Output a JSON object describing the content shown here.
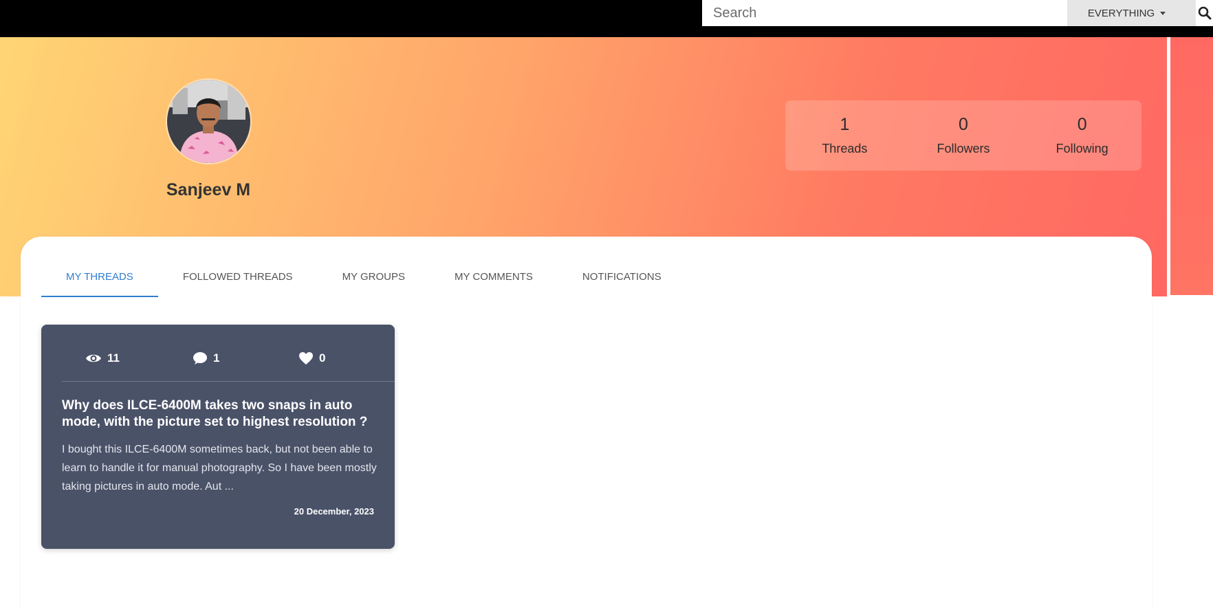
{
  "search": {
    "placeholder": "Search",
    "scope_label": "EVERYTHING"
  },
  "profile": {
    "name": "Sanjeev M",
    "stats": [
      {
        "value": "1",
        "label": "Threads"
      },
      {
        "value": "0",
        "label": "Followers"
      },
      {
        "value": "0",
        "label": "Following"
      }
    ]
  },
  "tabs": [
    {
      "label": "MY THREADS",
      "active": true
    },
    {
      "label": "FOLLOWED THREADS",
      "active": false
    },
    {
      "label": "MY GROUPS",
      "active": false
    },
    {
      "label": "MY COMMENTS",
      "active": false
    },
    {
      "label": "NOTIFICATIONS",
      "active": false
    }
  ],
  "threads": [
    {
      "views": "11",
      "comments": "1",
      "likes": "0",
      "title": "Why does ILCE-6400M takes two snaps in auto mode, with the picture set to highest resolution ?",
      "excerpt": "I bought this ILCE-6400M sometimes back, but not been able to learn to handle it for manual photography. So I have been mostly taking pictures in auto mode. Aut ...",
      "date": "20 December, 2023"
    }
  ],
  "icons": {
    "search": "search-icon",
    "caret": "caret-down-icon",
    "views": "eye-icon",
    "comments": "comment-icon",
    "likes": "heart-icon"
  },
  "colors": {
    "accent": "#2f7dd1",
    "card_background": "#4a5268",
    "banner_start": "#ffd574",
    "banner_end": "#ff6862"
  }
}
